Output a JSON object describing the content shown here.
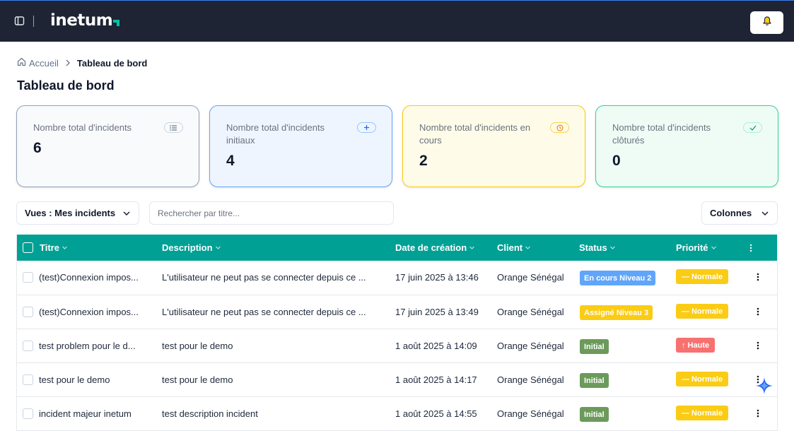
{
  "app": {
    "logo_text": "inetum"
  },
  "breadcrumb": {
    "home": "Accueil",
    "current": "Tableau de bord"
  },
  "page": {
    "title": "Tableau de bord"
  },
  "cards": [
    {
      "label": "Nombre total d'incidents",
      "value": "6",
      "icon": "list-icon",
      "color": "#94a3b8"
    },
    {
      "label": "Nombre total d'incidents initiaux",
      "value": "4",
      "icon": "plus-icon",
      "color": "#60a5fa"
    },
    {
      "label": "Nombre total d'incidents en cours",
      "value": "2",
      "icon": "clock-icon",
      "color": "#facc15"
    },
    {
      "label": "Nombre total d'incidents clôturés",
      "value": "0",
      "icon": "check-icon",
      "color": "#34d399"
    }
  ],
  "toolbar": {
    "view_select": "Vues : Mes incidents",
    "search_placeholder": "Rechercher par titre...",
    "columns_button": "Colonnes"
  },
  "table": {
    "columns": [
      "Titre",
      "Description",
      "Date de création",
      "Client",
      "Status",
      "Priorité"
    ],
    "rows": [
      {
        "title": "(test)Connexion impos...",
        "description": "L'utilisateur ne peut pas se connecter depuis ce ...",
        "date": "17 juin 2025 à 13:46",
        "client": "Orange Sénégal",
        "status": "En cours Niveau 2",
        "status_color": "#60a5fa",
        "priority": "— Normale",
        "priority_color": "#facc15"
      },
      {
        "title": "(test)Connexion impos...",
        "description": "L'utilisateur ne peut pas se connecter depuis ce ...",
        "date": "17 juin 2025 à 13:49",
        "client": "Orange Sénégal",
        "status": "Assigné Niveau 3",
        "status_color": "#facc15",
        "priority": "— Normale",
        "priority_color": "#facc15"
      },
      {
        "title": "test problem pour le d...",
        "description": "test pour le demo",
        "date": "1 août 2025 à 14:09",
        "client": "Orange Sénégal",
        "status": "Initial",
        "status_color": "#6b9a5b",
        "priority": "↑ Haute",
        "priority_color": "#f87171"
      },
      {
        "title": "test pour le demo",
        "description": "test pour le demo",
        "date": "1 août 2025 à 14:17",
        "client": "Orange Sénégal",
        "status": "Initial",
        "status_color": "#6b9a5b",
        "priority": "— Normale",
        "priority_color": "#facc15"
      },
      {
        "title": "incident majeur inetum",
        "description": "test description incident",
        "date": "1 août 2025 à 14:55",
        "client": "Orange Sénégal",
        "status": "Initial",
        "status_color": "#6b9a5b",
        "priority": "— Normale",
        "priority_color": "#facc15"
      }
    ]
  }
}
